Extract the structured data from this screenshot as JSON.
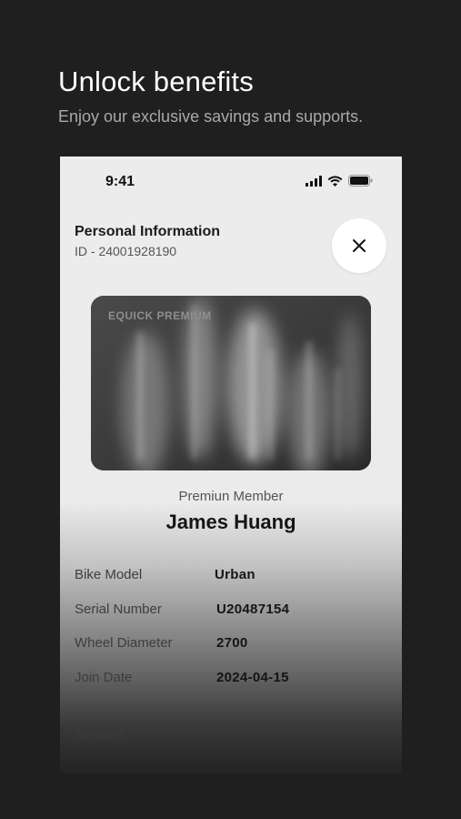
{
  "hero": {
    "title": "Unlock benefits",
    "subtitle": "Enjoy our exclusive savings and supports."
  },
  "status_bar": {
    "time": "9:41",
    "icons": [
      "cellular-signal-icon",
      "wifi-icon",
      "battery-icon"
    ]
  },
  "header": {
    "title": "Personal Information",
    "id_text": "ID - 24001928190",
    "close_icon": "close-icon"
  },
  "card": {
    "brand": "EQUICK PREMIUM"
  },
  "member": {
    "tier": "Premiun Member",
    "name": "James Huang"
  },
  "details": [
    {
      "label": "Bike Model",
      "value": "Urban"
    },
    {
      "label": "Serial Number",
      "value": "U20487154"
    },
    {
      "label": "Wheel Diameter",
      "value": "2700"
    },
    {
      "label": "Join Date",
      "value": "2024-04-15"
    }
  ],
  "services": {
    "label": "Services"
  },
  "colors": {
    "background": "#1f1f1f",
    "screen": "#ececec",
    "card": "#3a3a3a",
    "text_primary": "#151515"
  }
}
